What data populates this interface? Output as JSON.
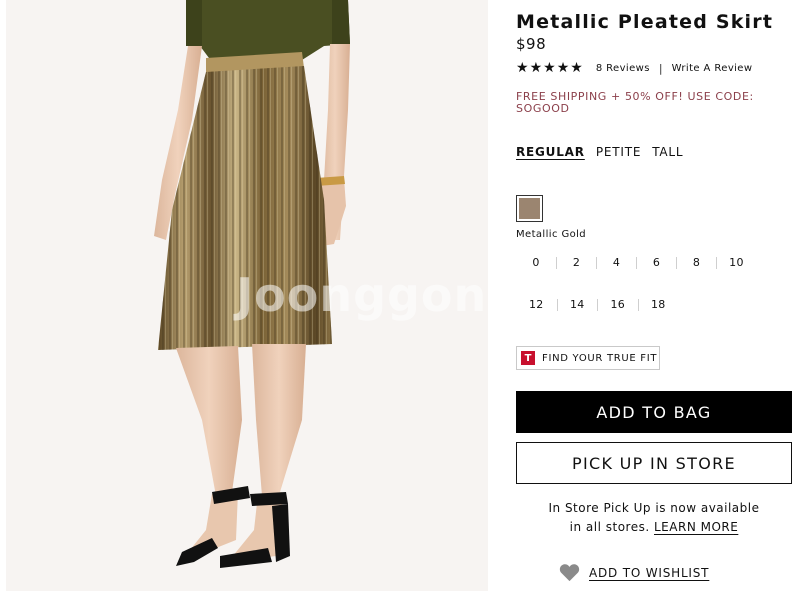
{
  "product": {
    "title": "Metallic Pleated Skirt",
    "price": "$98",
    "rating": 5,
    "reviews_label": "8 Reviews",
    "separator": "|",
    "write_review_label": "Write A Review",
    "promo": "FREE SHIPPING + 50% OFF! USE CODE: SOGOOD"
  },
  "photo": {
    "watermark": "Joonggon"
  },
  "size_types": [
    {
      "label": "REGULAR",
      "selected": true
    },
    {
      "label": "PETITE",
      "selected": false
    },
    {
      "label": "TALL",
      "selected": false
    }
  ],
  "color": {
    "name": "Metallic Gold",
    "swatch_hex": "#9b8570"
  },
  "sizes": {
    "row1": [
      "0",
      "2",
      "4",
      "6",
      "8",
      "10"
    ],
    "row2": [
      "12",
      "14",
      "16",
      "18"
    ]
  },
  "truefit": {
    "badge": "T",
    "label": "FIND YOUR TRUE FIT"
  },
  "actions": {
    "add_to_bag": "ADD TO BAG",
    "pick_up": "PICK UP IN STORE",
    "store_note_line1": "In Store Pick Up is now available",
    "store_note_line2": "in all stores.",
    "learn_more": "LEARN MORE",
    "wishlist": "ADD TO WISHLIST"
  },
  "icons": {
    "star": "★",
    "heart": "heart-icon"
  },
  "colors": {
    "promo": "#8b3f4a",
    "primary_button": "#000000",
    "truefit_red": "#c8102e"
  }
}
